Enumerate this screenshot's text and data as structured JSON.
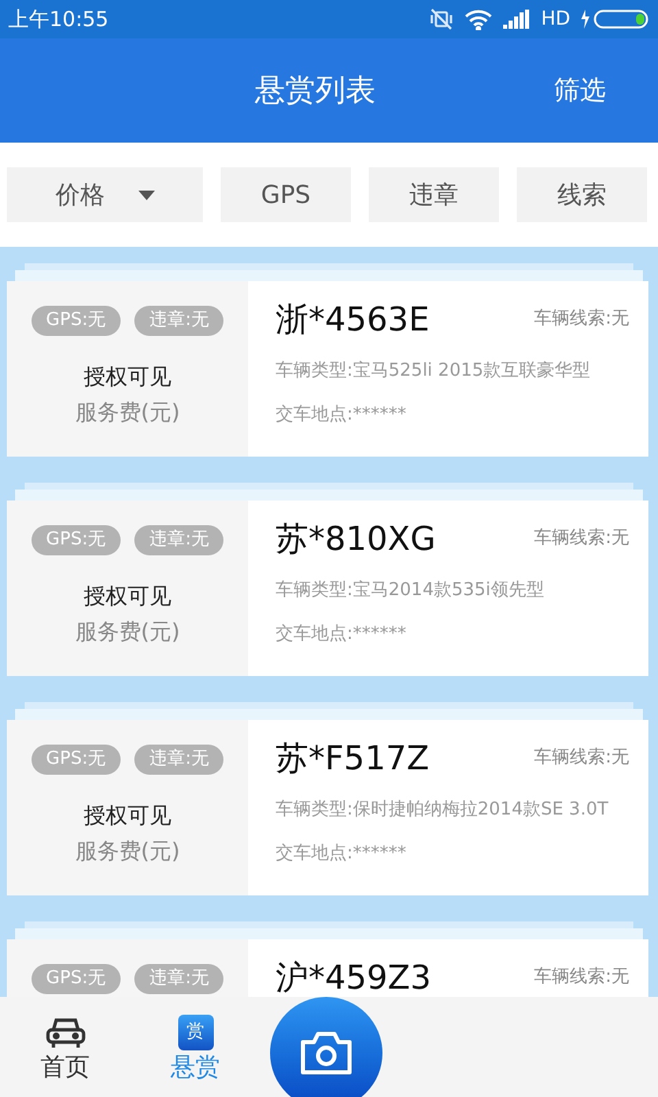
{
  "status_bar": {
    "time": "上午10:55",
    "network": "HD"
  },
  "header": {
    "title": "悬赏列表",
    "action": "筛选"
  },
  "filters": [
    {
      "label": "价格",
      "kind": "dropdown"
    },
    {
      "label": "GPS",
      "kind": "plain"
    },
    {
      "label": "违章",
      "kind": "plain"
    },
    {
      "label": "线索",
      "kind": "plain"
    }
  ],
  "cards": [
    {
      "tags": [
        "GPS:无",
        "违章:无"
      ],
      "visibility": "授权可见",
      "fee": "服务费(元)",
      "plate": "浙*4563E",
      "clue": "车辆线索:无",
      "model": "车辆类型:宝马525li 2015款互联豪华型",
      "location": "交车地点:******"
    },
    {
      "tags": [
        "GPS:无",
        "违章:无"
      ],
      "visibility": "授权可见",
      "fee": "服务费(元)",
      "plate": "苏*810XG",
      "clue": "车辆线索:无",
      "model": "车辆类型:宝马2014款535i领先型",
      "location": "交车地点:******"
    },
    {
      "tags": [
        "GPS:无",
        "违章:无"
      ],
      "visibility": "授权可见",
      "fee": "服务费(元)",
      "plate": "苏*F517Z",
      "clue": "车辆线索:无",
      "model": "车辆类型:保时捷帕纳梅拉2014款SE 3.0T",
      "location": "交车地点:******"
    },
    {
      "tags": [
        "GPS:无",
        "违章:无"
      ],
      "plate": "沪*459Z3",
      "clue": "车辆线索:无"
    }
  ],
  "nav": [
    {
      "label": "首页",
      "kind": "car",
      "selected": false
    },
    {
      "label": "悬赏",
      "kind": "reward",
      "icon_text": "赏",
      "selected": true
    }
  ]
}
